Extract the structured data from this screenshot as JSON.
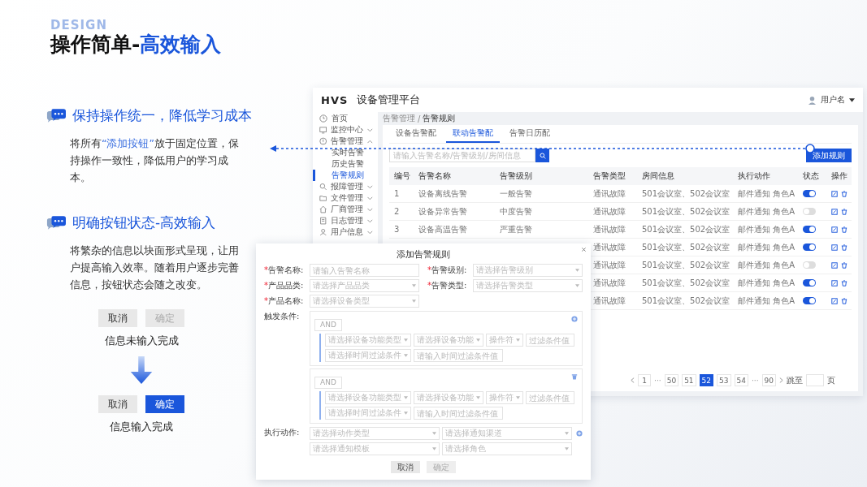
{
  "slide": {
    "backdrop_word": "DESIGN",
    "title": "操作简单-",
    "title_accent": "高效输入"
  },
  "points": [
    {
      "heading": "保持操作统一，降低学习成本",
      "body": [
        {
          "text": "将所有",
          "highlight": false
        },
        {
          "text": "“添加按钮”",
          "highlight": true
        },
        {
          "text": "放于固定位置，保持操作一致性，降低用户的学习成本。",
          "highlight": false
        }
      ]
    },
    {
      "heading": "明确按钮状态-高效输入",
      "body": [
        {
          "text": "将繁杂的信息以块面形式呈现，让用户提高输入效率。随着用户逐步完善信息，按钮状态会随之改变。",
          "highlight": false
        }
      ]
    }
  ],
  "button_states": [
    {
      "buttons": [
        {
          "label": "取消",
          "kind": "secondary"
        },
        {
          "label": "确定",
          "kind": "primary",
          "disabled": true
        }
      ],
      "caption": "信息未输入完成"
    },
    {
      "buttons": [
        {
          "label": "取消",
          "kind": "secondary"
        },
        {
          "label": "确定",
          "kind": "primary",
          "disabled": false
        }
      ],
      "caption": "信息输入完成"
    }
  ],
  "platform": {
    "logo": "HVS",
    "title": "设备管理平台",
    "user": "用户名",
    "sidebar": [
      {
        "label": "首页"
      },
      {
        "label": "监控中心",
        "expanded": false
      },
      {
        "label": "告警管理",
        "expanded": true,
        "children": [
          {
            "label": "实时告警",
            "selected": false
          },
          {
            "label": "历史告警",
            "selected": false
          },
          {
            "label": "告警规则",
            "selected": true
          }
        ]
      },
      {
        "label": "报障管理",
        "expanded": false
      },
      {
        "label": "文件管理",
        "expanded": false
      },
      {
        "label": "厂商管理",
        "expanded": false
      },
      {
        "label": "日志管理",
        "expanded": false
      },
      {
        "label": "用户信息",
        "expanded": false
      }
    ],
    "breadcrumb": {
      "items": [
        "告警管理",
        "告警规则"
      ],
      "separator": "/"
    },
    "tabs": [
      {
        "label": "设备告警配",
        "selected": false
      },
      {
        "label": "联动告警配",
        "selected": true
      },
      {
        "label": "告警日历配",
        "selected": false
      }
    ],
    "search": {
      "placeholder": "请输入告警名称/告警级别/房间信息"
    },
    "add_button": "添加规则",
    "columns": [
      "编号",
      "告警名称",
      "告警级别",
      "告警类型",
      "房间信息",
      "执行动作",
      "状态",
      "操作"
    ],
    "rows": [
      {
        "no": "1",
        "name": "设备离线告警",
        "level": "一般告警",
        "type": "通讯故障",
        "rooms": "501会议室、502会议室",
        "action": "邮件通知 角色A",
        "enabled": true
      },
      {
        "no": "2",
        "name": "设备异常告警",
        "level": "中度告警",
        "type": "通讯故障",
        "rooms": "501会议室、502会议室",
        "action": "邮件通知 角色A",
        "enabled": false
      },
      {
        "no": "3",
        "name": "设备高温告警",
        "level": "严重告警",
        "type": "通讯故障",
        "rooms": "501会议室、502会议室",
        "action": "邮件通知 角色A",
        "enabled": true
      },
      {
        "type": "通讯故障",
        "rooms": "501会议室、502会议室",
        "action": "邮件通知 角色A",
        "enabled": true
      },
      {
        "type": "通讯故障",
        "rooms": "501会议室、502会议室",
        "action": "邮件通知 角色A",
        "enabled": false
      },
      {
        "type": "通讯故障",
        "rooms": "501会议室、502会议室",
        "action": "邮件通知 角色A",
        "enabled": true
      },
      {
        "type": "通讯故障",
        "rooms": "501会议室、502会议室",
        "action": "邮件通知 角色A",
        "enabled": true
      }
    ],
    "pagination": {
      "pages": [
        {
          "label": "1",
          "kind": "page",
          "selected": false
        },
        {
          "label": "···",
          "kind": "ellipsis"
        },
        {
          "label": "50",
          "kind": "page",
          "selected": false
        },
        {
          "label": "51",
          "kind": "page",
          "selected": false
        },
        {
          "label": "52",
          "kind": "page",
          "selected": true
        },
        {
          "label": "53",
          "kind": "page",
          "selected": false
        },
        {
          "label": "54",
          "kind": "page",
          "selected": false
        },
        {
          "label": "···",
          "kind": "ellipsis"
        },
        {
          "label": "90",
          "kind": "page",
          "selected": false
        }
      ],
      "jump_label": "跳至",
      "unit": "页"
    }
  },
  "modal": {
    "title": "添加告警规则",
    "fields": [
      {
        "mark": "*",
        "label": "告警名称:",
        "kind": "input",
        "placeholder": "请输入告警名称"
      },
      {
        "mark": "*",
        "label": "告警级别:",
        "kind": "select",
        "placeholder": "请选择告警级别"
      },
      {
        "mark": "*",
        "label": "产品品类:",
        "kind": "select",
        "placeholder": "请选择产品品类"
      },
      {
        "mark": "*",
        "label": "告警类型:",
        "kind": "select",
        "placeholder": "请选择告警类型"
      },
      {
        "mark": "*",
        "label": "产品名称:",
        "kind": "select",
        "placeholder": "请选择设备类型"
      }
    ],
    "condition_label": "触发条件:",
    "conditions": [
      {
        "operator": "AND",
        "removable": false,
        "fields": [
          {
            "kind": "select",
            "placeholder": "请选择设备功能类型"
          },
          {
            "kind": "select",
            "placeholder": "请选择设备功能"
          },
          {
            "kind": "select",
            "placeholder": "操作符"
          },
          {
            "kind": "input",
            "placeholder": "过滤条件值"
          },
          {
            "kind": "select",
            "placeholder": "请选择时间过滤条件"
          },
          {
            "kind": "input",
            "placeholder": "请输入时间过滤条件值"
          }
        ]
      },
      {
        "operator": "AND",
        "removable": true,
        "fields": [
          {
            "kind": "select",
            "placeholder": "请选择设备功能类型"
          },
          {
            "kind": "select",
            "placeholder": "请选择设备功能"
          },
          {
            "kind": "select",
            "placeholder": "操作符"
          },
          {
            "kind": "input",
            "placeholder": "过滤条件值"
          },
          {
            "kind": "select",
            "placeholder": "请选择时间过滤条件"
          },
          {
            "kind": "input",
            "placeholder": "请输入时间过滤条件值"
          }
        ]
      }
    ],
    "action_label": "执行动作:",
    "actions": [
      {
        "kind": "select",
        "placeholder": "请选择动作类型"
      },
      {
        "kind": "select",
        "placeholder": "请选择通知渠道"
      },
      {
        "kind": "select",
        "placeholder": "请选择通知模板"
      },
      {
        "kind": "select",
        "placeholder": "请选择角色"
      }
    ],
    "buttons": [
      {
        "label": "取消",
        "kind": "secondary"
      },
      {
        "label": "确定",
        "kind": "primary",
        "disabled": true
      }
    ]
  }
}
